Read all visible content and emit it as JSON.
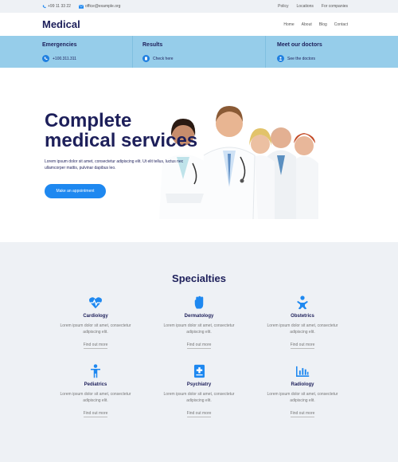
{
  "topbar": {
    "phone": "+99 11 33 22",
    "email": "office@example.org",
    "links": [
      "Policy",
      "Locations",
      "For companies"
    ]
  },
  "header": {
    "logo": "Medical",
    "nav": [
      "Home",
      "About",
      "Blog",
      "Contact"
    ]
  },
  "infobar": {
    "emergencies_title": "Emergencies",
    "emergencies_phone": "+100.311.311",
    "results_title": "Results",
    "results_link": "Check here",
    "doctors_title": "Meet our doctors",
    "doctors_link": "See the doctors"
  },
  "hero": {
    "title_line1": "Complete",
    "title_line2": "medical services",
    "description": "Lorem ipsum dolor sit amet, consectetur adipiscing elit. Ut elit tellus, luctus nec ullamcorper mattis, pulvinar dapibus leo.",
    "button": "Make an appointment"
  },
  "specialties": {
    "title": "Specialties",
    "items": [
      {
        "name": "Cardiology",
        "text": "Lorem ipsum dolor sit amet, consectetur adipiscing elit.",
        "link": "Find out more",
        "icon": "heartbeat-icon"
      },
      {
        "name": "Dermatology",
        "text": "Lorem ipsum dolor sit amet, consectetur adipiscing elit.",
        "link": "Find out more",
        "icon": "hand-icon"
      },
      {
        "name": "Obstetrics",
        "text": "Lorem ipsum dolor sit amet, consectetur adipiscing elit.",
        "link": "Find out more",
        "icon": "baby-icon"
      },
      {
        "name": "Pediatrics",
        "text": "Lorem ipsum dolor sit amet, consectetur adipiscing elit.",
        "link": "Find out more",
        "icon": "child-icon"
      },
      {
        "name": "Psychiatry",
        "text": "Lorem ipsum dolor sit amet, consectetur adipiscing elit.",
        "link": "Find out more",
        "icon": "medical-file-icon"
      },
      {
        "name": "Radiology",
        "text": "Lorem ipsum dolor sit amet, consectetur adipiscing elit.",
        "link": "Find out more",
        "icon": "chart-bars-icon"
      }
    ]
  },
  "colors": {
    "brand_navy": "#1d1f5a",
    "accent_blue": "#1e88f0",
    "infobar_bg": "#96cdea"
  }
}
